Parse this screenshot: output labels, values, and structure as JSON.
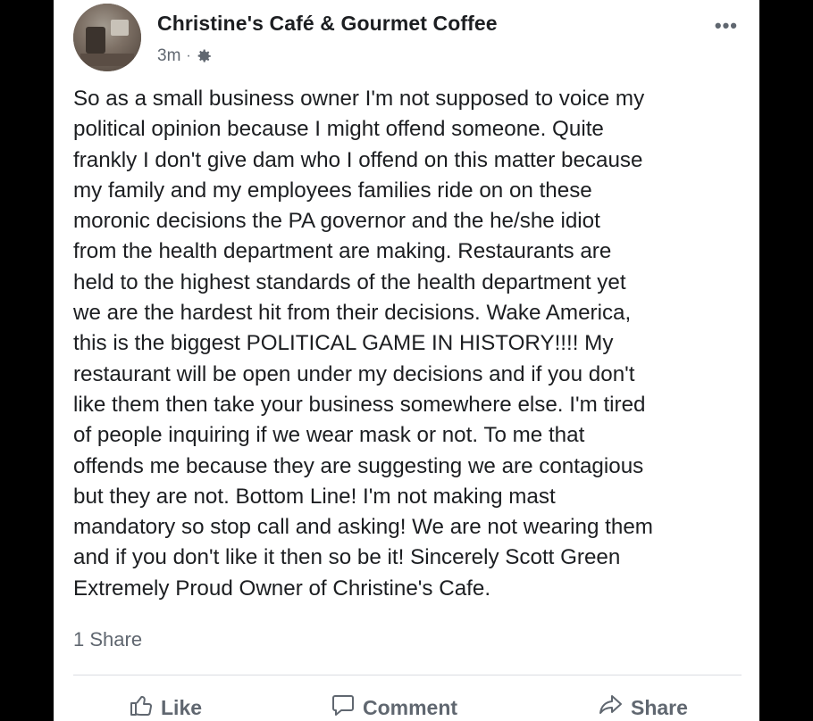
{
  "post": {
    "page_name": "Christine's Café & Gourmet Coffee",
    "time": "3m",
    "separator": "·",
    "audience_icon": "gear-icon",
    "more_icon": "more-options-icon",
    "text_lines": [
      "So as a small business owner I'm not supposed to voice my",
      "political opinion because I might offend someone. Quite",
      "frankly I don't give dam who I offend on this matter because",
      "my family and my employees families ride on on these",
      "moronic decisions the PA governor and the he/she idiot",
      "from the health department are making. Restaurants are",
      "held to the highest standards of the health department yet",
      "we are the hardest hit from their decisions. Wake America,",
      "this is the biggest POLITICAL GAME IN HISTORY!!!! My",
      "restaurant will be open under my decisions and if you don't",
      "like them then take your business somewhere else. I'm tired",
      "of people inquiring if we wear mask or not. To me that",
      "offends me because they are suggesting we are contagious",
      "but they are not. Bottom Line! I'm not making mast",
      "mandatory so stop call and asking! We are not wearing them",
      "and if you don't like it then so be it! Sincerely Scott Green",
      "Extremely Proud Owner of Christine's Cafe."
    ],
    "shares": "1 Share"
  },
  "actions": {
    "like_label": "Like",
    "comment_label": "Comment",
    "share_label": "Share"
  },
  "colors": {
    "text": "#1c1e21",
    "secondary": "#606770",
    "divider": "#dadde1"
  }
}
